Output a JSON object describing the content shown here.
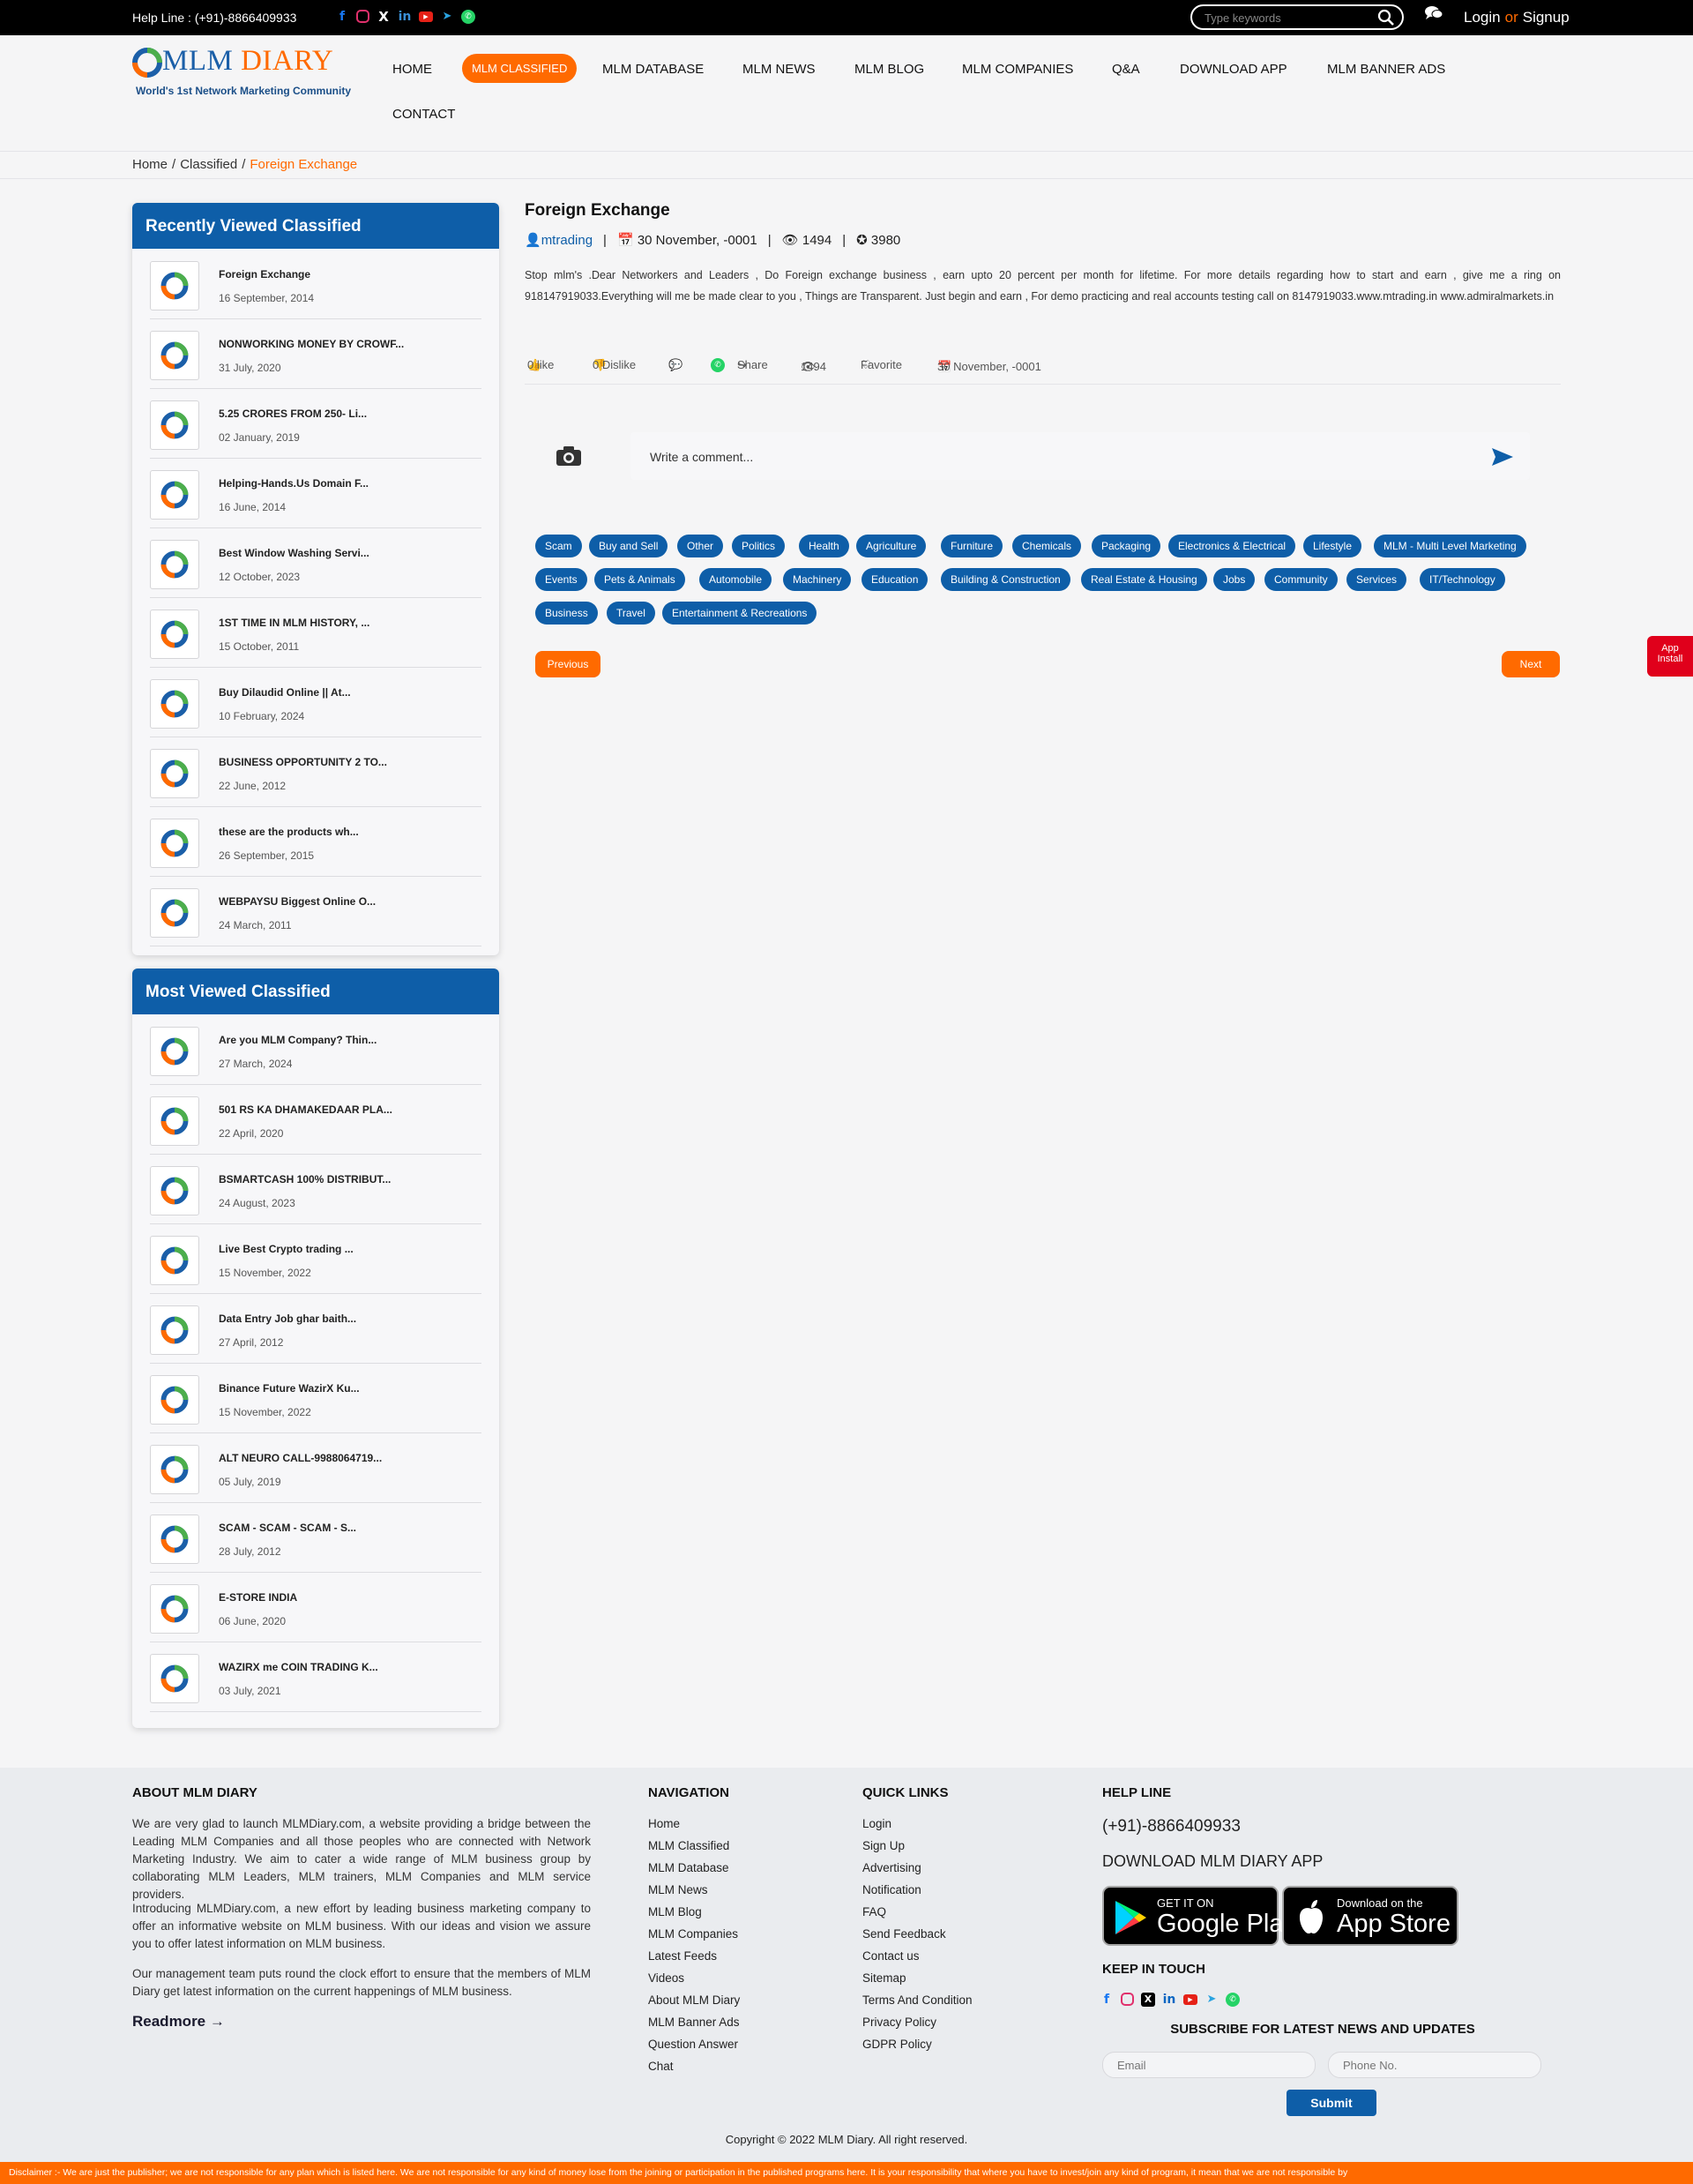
{
  "topbar": {
    "help_line": "Help Line : (+91)-8866409933",
    "social_icons": [
      "facebook-icon",
      "instagram-icon",
      "x-icon",
      "linkedin-icon",
      "youtube-icon",
      "telegram-icon",
      "whatsapp-icon"
    ],
    "search_placeholder": "Type keywords",
    "login": "Login",
    "or": "or",
    "signup": "Signup"
  },
  "brand": {
    "name_a": "MLM",
    "name_b": "DIARY",
    "tagline": "World's 1st Network Marketing Community",
    "accent": "#ff6a00",
    "primary": "#0e5ea8"
  },
  "nav": {
    "home": "HOME",
    "classified": "MLM CLASSIFIED",
    "database": "MLM DATABASE",
    "news": "MLM NEWS",
    "blog": "MLM BLOG",
    "companies": "MLM COMPANIES",
    "qa": "Q&A",
    "download": "DOWNLOAD APP",
    "banner": "MLM BANNER ADS",
    "contact": "CONTACT"
  },
  "breadcrumb": {
    "home": "Home",
    "sep": "/",
    "classified": "Classified",
    "current": "Foreign Exchange"
  },
  "recent": {
    "heading": "Recently Viewed Classified",
    "items": [
      {
        "title": "Foreign Exchange",
        "date": "16 September, 2014"
      },
      {
        "title": "NONWORKING MONEY BY CROWF...",
        "date": "31 July, 2020"
      },
      {
        "title": "5.25 CRORES FROM 250- Li...",
        "date": "02 January, 2019"
      },
      {
        "title": "Helping-Hands.Us Domain F...",
        "date": "16 June, 2014"
      },
      {
        "title": "Best Window Washing Servi...",
        "date": "12 October, 2023"
      },
      {
        "title": "1ST TIME IN MLM HISTORY, ...",
        "date": "15 October, 2011"
      },
      {
        "title": "Buy Dilaudid Online || At...",
        "date": "10 February, 2024"
      },
      {
        "title": "BUSINESS OPPORTUNITY 2 TO...",
        "date": "22 June, 2012"
      },
      {
        "title": "these are the products wh...",
        "date": "26 September, 2015"
      },
      {
        "title": "WEBPAYSU Biggest Online O...",
        "date": "24 March, 2011"
      }
    ]
  },
  "most": {
    "heading": "Most Viewed Classified",
    "items": [
      {
        "title": "Are you MLM Company? Thin...",
        "date": "27 March, 2024"
      },
      {
        "title": "501 RS KA DHAMAKEDAAR PLA...",
        "date": "22 April, 2020"
      },
      {
        "title": "BSMARTCASH 100% DISTRIBUT...",
        "date": "24 August, 2023"
      },
      {
        "title": "Live Best Crypto trading ...",
        "date": "15 November, 2022"
      },
      {
        "title": "Data Entry Job ghar baith...",
        "date": "27 April, 2012"
      },
      {
        "title": "Binance Future WazirX Ku...",
        "date": "15 November, 2022"
      },
      {
        "title": "ALT NEURO CALL-9988064719...",
        "date": "05 July, 2019"
      },
      {
        "title": "SCAM - SCAM - SCAM - S...",
        "date": "28 July, 2012"
      },
      {
        "title": "E-STORE INDIA",
        "date": "06 June, 2020"
      },
      {
        "title": "WAZIRX me COIN TRADING K...",
        "date": "03 July, 2021"
      }
    ]
  },
  "post": {
    "title": "Foreign Exchange",
    "author": "mtrading",
    "date": "30 November, -0001",
    "views": "1494",
    "points": "3980",
    "description": "Stop mlm's .Dear Networkers and Leaders , Do Foreign exchange business , earn upto 20 percent per month for lifetime. For more details regarding how to start and earn , give me a ring on 918147919033.Everything will me be made clear to you , Things are Transparent. Just begin and earn , For demo practicing and real accounts testing call on 8147919033.www.mtrading.in www.admiralmarkets.in",
    "like": "0 like",
    "dislike": "0 Dislike",
    "comments": "0",
    "share": "Share",
    "views_action": "1494",
    "favorite": "Favorite",
    "date_action": "30 November, -0001"
  },
  "comment": {
    "placeholder": "Write a comment..."
  },
  "tags": [
    "Scam",
    "Buy and Sell",
    "Other",
    "Politics",
    "Health",
    "Agriculture",
    "Furniture",
    "Chemicals",
    "Packaging",
    "Electronics & Electrical",
    "Lifestyle",
    "MLM - Multi Level Marketing",
    "Events",
    "Pets & Animals",
    "Automobile",
    "Machinery",
    "Education",
    "Building & Construction",
    "Real Estate & Housing",
    "Jobs",
    "Community",
    "Services",
    "IT/Technology",
    "Business",
    "Travel",
    "Entertainment & Recreations"
  ],
  "pager": {
    "previous": "Previous",
    "next": "Next"
  },
  "app_install": {
    "line1": "App",
    "line2": "Install"
  },
  "footer": {
    "about_heading": "ABOUT MLM DIARY",
    "about_p1": "We are very glad to launch MLMDiary.com, a website providing a bridge between the Leading MLM Companies and all those peoples who are connected with Network Marketing Industry. We aim to cater a wide range of MLM business group by collaborating MLM Leaders, MLM trainers, MLM Companies and MLM service providers.",
    "about_p2": "Introducing MLMDiary.com, a new effort by leading business marketing company to offer an informative website on MLM business. With our ideas and vision we assure you to offer latest information on MLM business.",
    "about_p3": "Our management team puts round the clock effort to ensure that the members of MLM Diary get latest information on the current happenings of MLM business.",
    "readmore": "Readmore",
    "nav_heading": "NAVIGATION",
    "nav_links": [
      "Home",
      "MLM Classified",
      "MLM Database",
      "MLM News",
      "MLM Blog",
      "MLM Companies",
      "Latest Feeds",
      "Videos",
      "About MLM Diary",
      "MLM Banner Ads",
      "Question Answer",
      "Chat"
    ],
    "quick_heading": "QUICK LINKS",
    "quick_links": [
      "Login",
      "Sign Up",
      "Advertising",
      "Notification",
      "FAQ",
      "Send Feedback",
      "Contact us",
      "Sitemap",
      "Terms And Condition",
      "Privacy Policy",
      "GDPR Policy"
    ],
    "help_heading": "HELP LINE",
    "help_phone": "(+91)-8866409933",
    "download_heading": "DOWNLOAD MLM DIARY APP",
    "google_l1": "GET IT ON",
    "google_l2": "Google Play",
    "apple_l1": "Download on the",
    "apple_l2": "App Store",
    "keep_heading": "KEEP IN TOUCH",
    "subscribe_heading": "SUBSCRIBE FOR LATEST NEWS AND UPDATES",
    "email_placeholder": "Email",
    "phone_placeholder": "Phone No.",
    "submit": "Submit",
    "copyright": "Copyright © 2022 MLM Diary. All right reserved.",
    "disclaimer": "Disclaimer :- We are just the publisher; we are not responsible for any plan which is listed here. We are not responsible for any kind of money lose from the joining or participation in the published programs here. It is your responsibility that where you have to invest/join any kind of program, it mean that we are not responsible by"
  }
}
